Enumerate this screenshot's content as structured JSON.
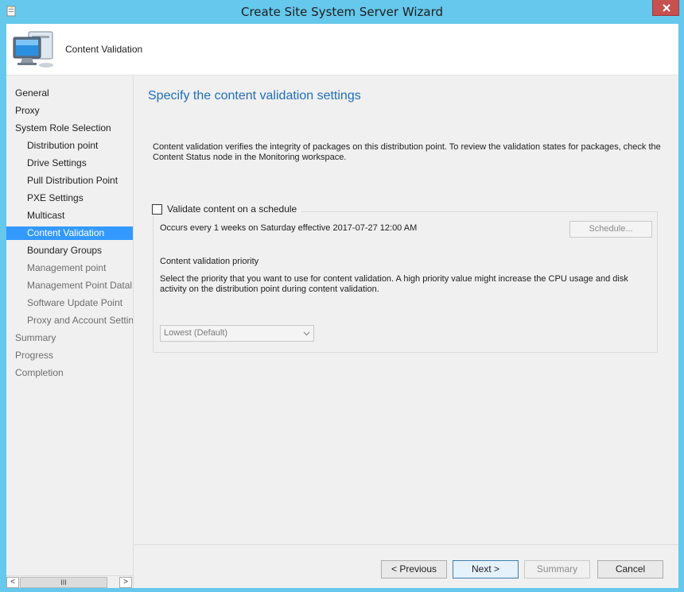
{
  "window": {
    "title": "Create Site System Server Wizard"
  },
  "header": {
    "title": "Content Validation",
    "icon": "computer-monitor-icon"
  },
  "nav": {
    "items": [
      {
        "label": "General",
        "level": 0,
        "state": "normal"
      },
      {
        "label": "Proxy",
        "level": 0,
        "state": "normal"
      },
      {
        "label": "System Role Selection",
        "level": 0,
        "state": "normal"
      },
      {
        "label": "Distribution point",
        "level": 1,
        "state": "normal"
      },
      {
        "label": "Drive Settings",
        "level": 1,
        "state": "normal"
      },
      {
        "label": "Pull Distribution Point",
        "level": 1,
        "state": "normal"
      },
      {
        "label": "PXE Settings",
        "level": 1,
        "state": "normal"
      },
      {
        "label": "Multicast",
        "level": 1,
        "state": "normal"
      },
      {
        "label": "Content Validation",
        "level": 1,
        "state": "selected"
      },
      {
        "label": "Boundary Groups",
        "level": 1,
        "state": "normal"
      },
      {
        "label": "Management point",
        "level": 1,
        "state": "dim"
      },
      {
        "label": "Management Point Datal",
        "level": 1,
        "state": "dim"
      },
      {
        "label": "Software Update Point",
        "level": 1,
        "state": "dim"
      },
      {
        "label": "Proxy and Account Settin",
        "level": 1,
        "state": "dim"
      },
      {
        "label": "Summary",
        "level": 0,
        "state": "dim"
      },
      {
        "label": "Progress",
        "level": 0,
        "state": "dim"
      },
      {
        "label": "Completion",
        "level": 0,
        "state": "dim"
      }
    ],
    "scroll_left": "<",
    "scroll_right": ">",
    "scroll_thumb": "III"
  },
  "main": {
    "heading": "Specify the content validation settings",
    "description": "Content validation verifies the integrity of packages on this distribution point. To review the validation states for packages, check the Content Status node in the Monitoring workspace.",
    "validate_checkbox": {
      "label": "Validate content on a schedule",
      "checked": false
    },
    "occurs_text": "Occurs every 1 weeks on Saturday effective 2017-07-27 12:00 AM",
    "schedule_button": "Schedule...",
    "priority_heading": "Content validation priority",
    "priority_desc": "Select the priority that you want to use for content validation. A high priority value might increase the CPU usage and disk activity on the distribution point during content validation.",
    "priority_select": {
      "value": "Lowest (Default)"
    }
  },
  "footer": {
    "previous": "< Previous",
    "next": "Next >",
    "summary": "Summary",
    "cancel": "Cancel"
  },
  "colors": {
    "frame": "#65c8ec",
    "selection": "#3399ff",
    "heading": "#1f6dbf",
    "close": "#c75050"
  }
}
